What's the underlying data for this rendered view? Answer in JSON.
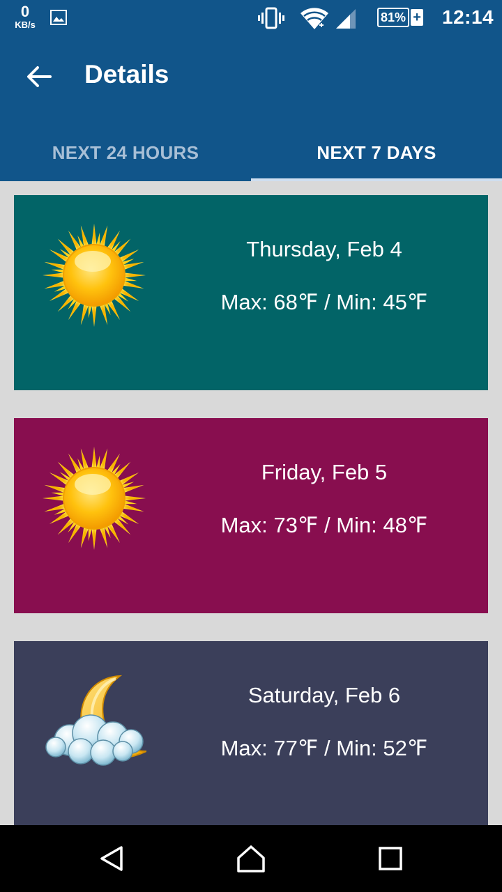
{
  "status_bar": {
    "net_speed_value": "0",
    "net_speed_unit": "KB/s",
    "battery_percent": "81%",
    "battery_plus": "+",
    "time": "12:14",
    "icons": [
      "gallery-icon",
      "vibrate-icon",
      "wifi-icon",
      "signal-icon",
      "battery-icon"
    ]
  },
  "app_bar": {
    "back_icon": "arrow-back-icon",
    "title": "Details"
  },
  "tabs": [
    {
      "label": "NEXT 24 HOURS",
      "selected": false
    },
    {
      "label": "NEXT 7 DAYS",
      "selected": true
    }
  ],
  "forecast": [
    {
      "date": "Thursday, Feb 4",
      "temps": "Max: 68℉ / Min: 45℉",
      "icon": "sunny-icon",
      "color": "#026467"
    },
    {
      "date": "Friday, Feb 5",
      "temps": "Max: 73℉ / Min: 48℉",
      "icon": "sunny-icon",
      "color": "#880e4f"
    },
    {
      "date": "Saturday, Feb 6",
      "temps": "Max: 77℉ / Min: 52℉",
      "icon": "night-cloudy-icon",
      "color": "#3b3f5a"
    }
  ],
  "nav_bar": {
    "buttons": [
      "back-triangle-icon",
      "home-icon",
      "recents-icon"
    ]
  },
  "colors": {
    "primary": "#11558a",
    "background": "#d9d9d9"
  }
}
